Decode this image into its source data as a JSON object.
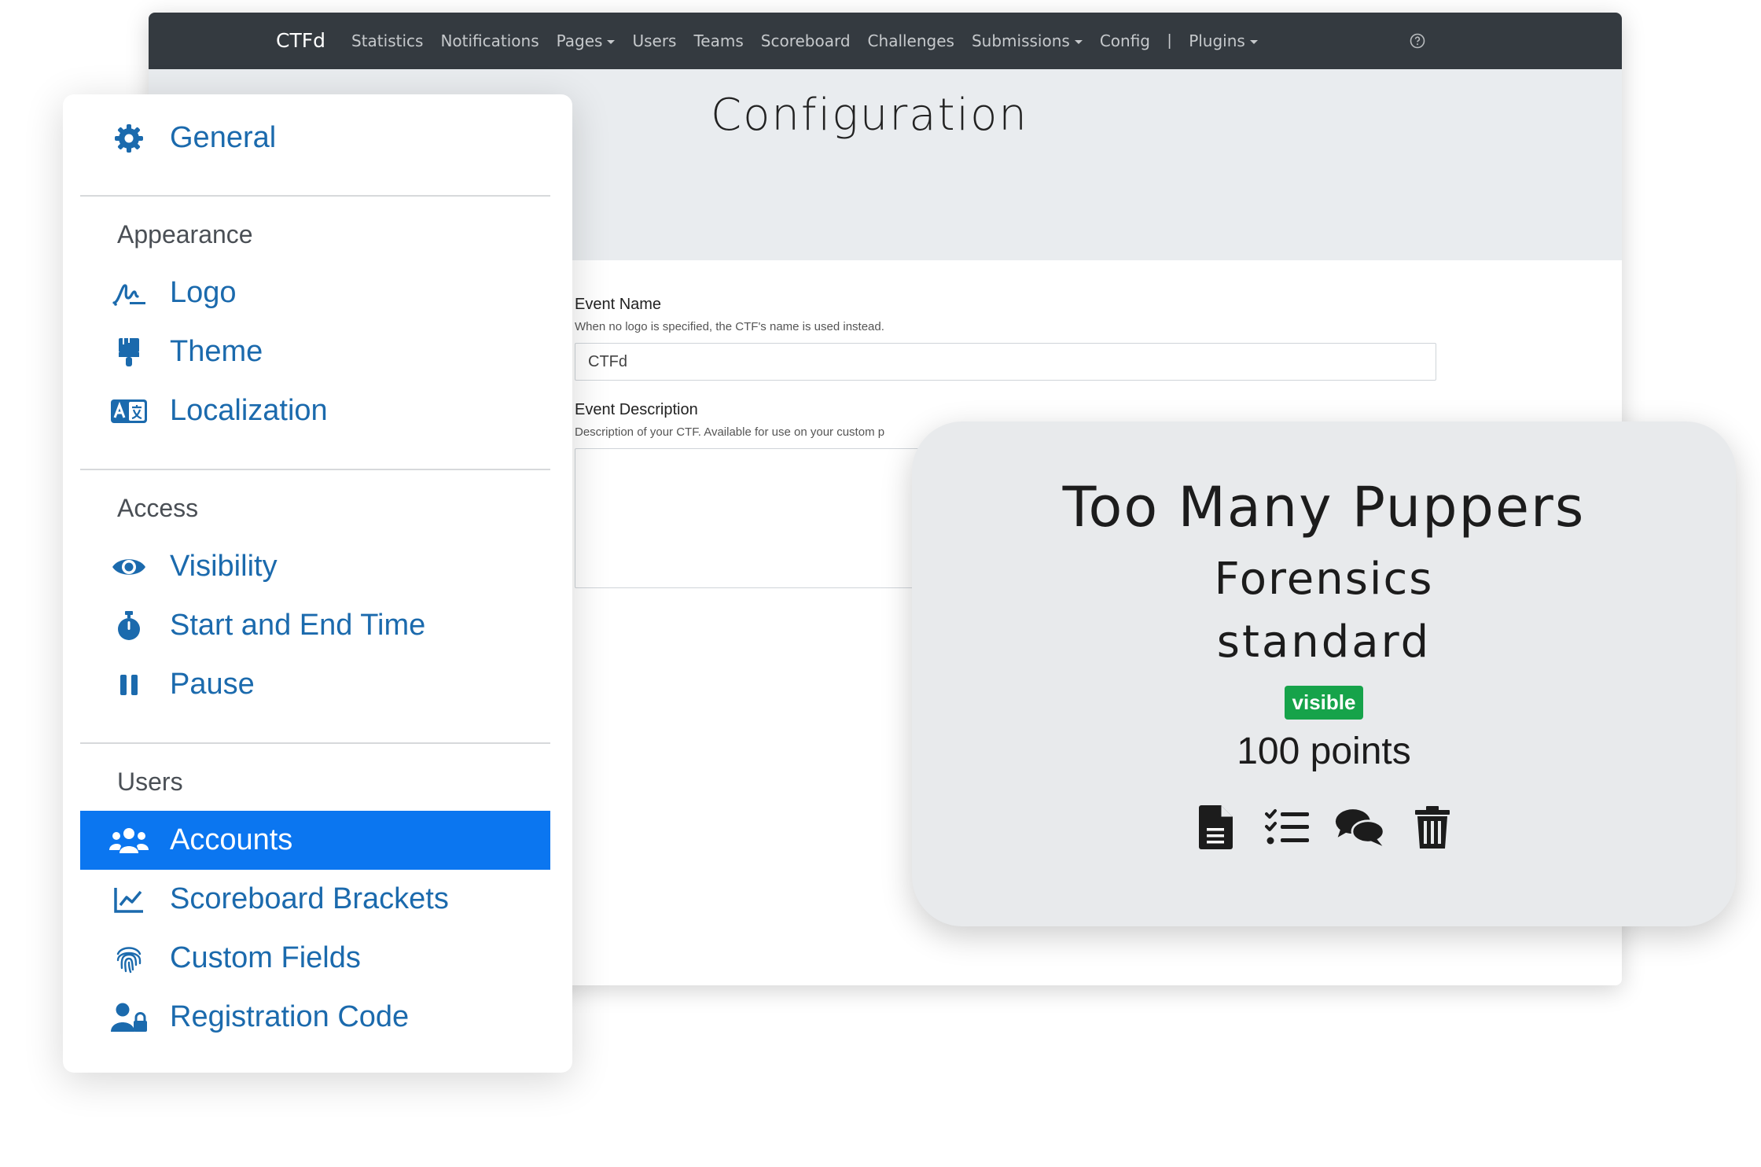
{
  "navbar": {
    "brand": "CTFd",
    "items": [
      {
        "label": "Statistics",
        "dropdown": false
      },
      {
        "label": "Notifications",
        "dropdown": false
      },
      {
        "label": "Pages",
        "dropdown": true
      },
      {
        "label": "Users",
        "dropdown": false
      },
      {
        "label": "Teams",
        "dropdown": false
      },
      {
        "label": "Scoreboard",
        "dropdown": false
      },
      {
        "label": "Challenges",
        "dropdown": false
      },
      {
        "label": "Submissions",
        "dropdown": true
      },
      {
        "label": "Config",
        "dropdown": false
      }
    ],
    "separator": "|",
    "plugins": {
      "label": "Plugins",
      "dropdown": true
    },
    "help_icon": "question-circle-icon"
  },
  "page": {
    "title": "Configuration"
  },
  "form": {
    "event_name": {
      "label": "Event Name",
      "help": "When no logo is specified, the CTF's name is used instead.",
      "value": "CTFd"
    },
    "event_description": {
      "label": "Event Description",
      "help": "Description of your CTF. Available for use on your custom p"
    }
  },
  "sidebar": {
    "general": {
      "label": "General",
      "icon": "gear-icon"
    },
    "sections": [
      {
        "heading": "Appearance",
        "items": [
          {
            "label": "Logo",
            "icon": "signature-icon"
          },
          {
            "label": "Theme",
            "icon": "paint-brush-icon"
          },
          {
            "label": "Localization",
            "icon": "language-icon"
          }
        ]
      },
      {
        "heading": "Access",
        "items": [
          {
            "label": "Visibility",
            "icon": "eye-icon"
          },
          {
            "label": "Start and End Time",
            "icon": "stopwatch-icon"
          },
          {
            "label": "Pause",
            "icon": "pause-icon"
          }
        ]
      },
      {
        "heading": "Users",
        "items": [
          {
            "label": "Accounts",
            "icon": "users-icon",
            "active": true
          },
          {
            "label": "Scoreboard Brackets",
            "icon": "line-chart-icon"
          },
          {
            "label": "Custom Fields",
            "icon": "fingerprint-icon"
          },
          {
            "label": "Registration Code",
            "icon": "user-lock-icon"
          }
        ]
      }
    ],
    "active_color": "#0b76f0",
    "link_color": "#1b6aad"
  },
  "challenge": {
    "name": "Too Many Puppers",
    "category": "Forensics",
    "type": "standard",
    "state": "visible",
    "state_color": "#16a34a",
    "points": "100 points",
    "actions": [
      "file-icon",
      "tasks-icon",
      "comments-icon",
      "trash-icon"
    ]
  }
}
